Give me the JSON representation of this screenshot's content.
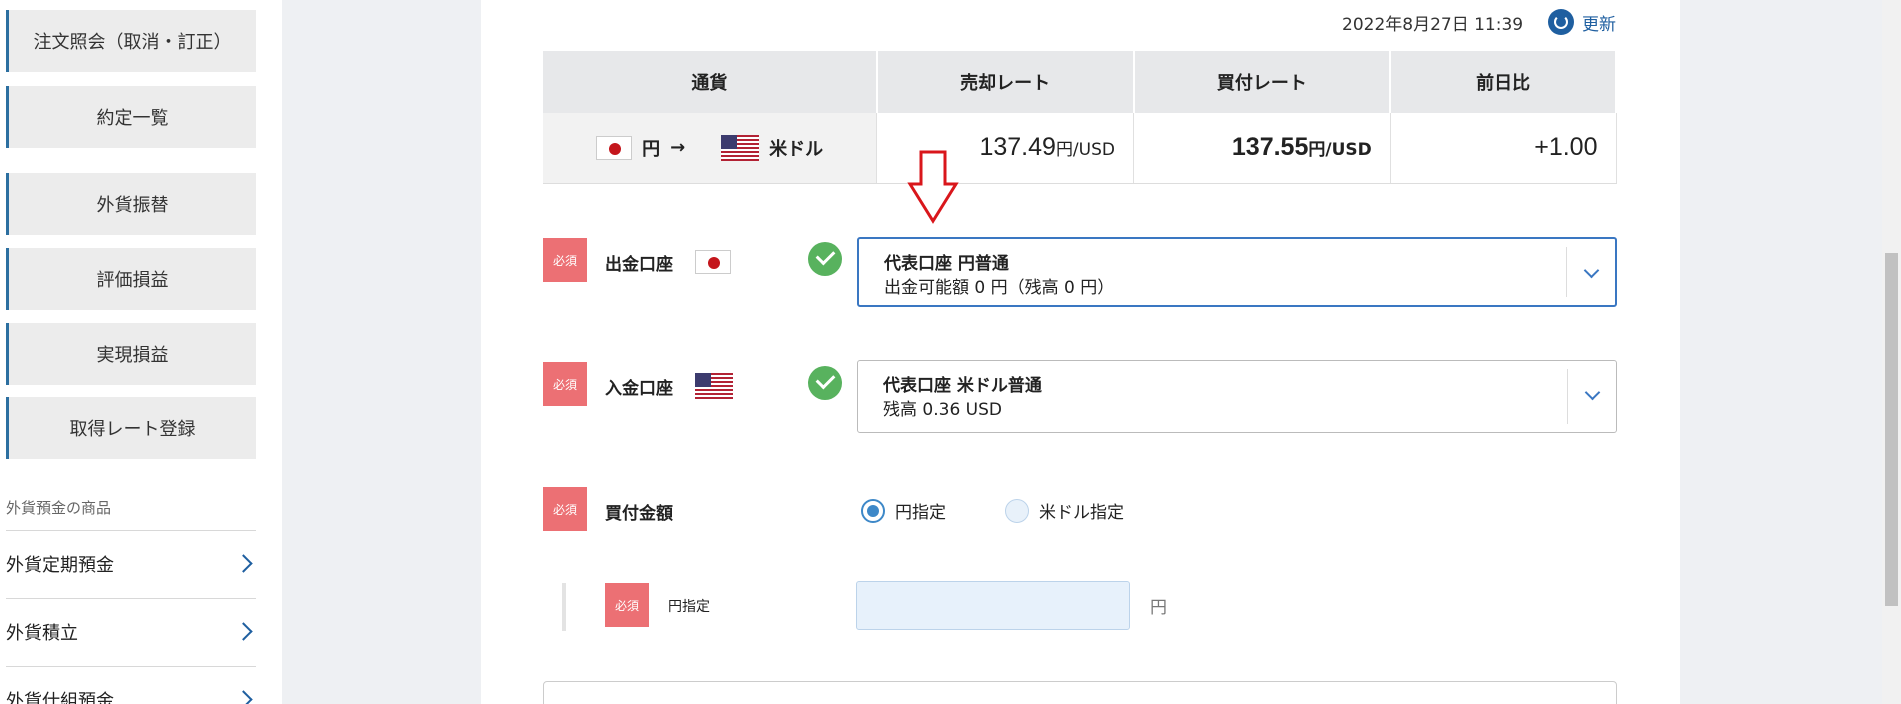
{
  "sidebar": {
    "menu": [
      {
        "label": "注文照会（取消・訂正）"
      },
      {
        "label": "約定一覧"
      },
      {
        "label": "外貨振替"
      },
      {
        "label": "評価損益"
      },
      {
        "label": "実現損益"
      },
      {
        "label": "取得レート登録"
      }
    ],
    "section_label": "外貨預金の商品",
    "products": [
      {
        "label": "外貨定期預金"
      },
      {
        "label": "外貨積立"
      },
      {
        "label": "外貨仕組預金"
      }
    ]
  },
  "header": {
    "updated_at": "2022年8月27日 11:39",
    "refresh_label": "更新"
  },
  "rate_table": {
    "columns": [
      "通貨",
      "売却レート",
      "買付レート",
      "前日比"
    ],
    "row": {
      "from_currency": "円",
      "arrow": "→",
      "to_currency": "米ドル",
      "sell_rate": "137.49",
      "sell_unit": "円/USD",
      "buy_rate": "137.55",
      "buy_unit": "円/USD",
      "change": "+1.00"
    }
  },
  "form": {
    "required_badge": "必須",
    "withdraw": {
      "label": "出金口座",
      "account": "代表口座 円普通",
      "detail": "出金可能額 0 円（残高 0 円）"
    },
    "deposit": {
      "label": "入金口座",
      "account": "代表口座 米ドル普通",
      "detail": "残高 0.36 USD"
    },
    "amount": {
      "label": "買付金額",
      "options": [
        "円指定",
        "米ドル指定"
      ],
      "selected": "円指定",
      "sub_label": "円指定",
      "value": "",
      "unit": "円"
    }
  },
  "colors": {
    "accent": "#1f5fa0",
    "required": "#ec7074",
    "check": "#58b25e",
    "annotation_arrow": "#d9161b"
  }
}
